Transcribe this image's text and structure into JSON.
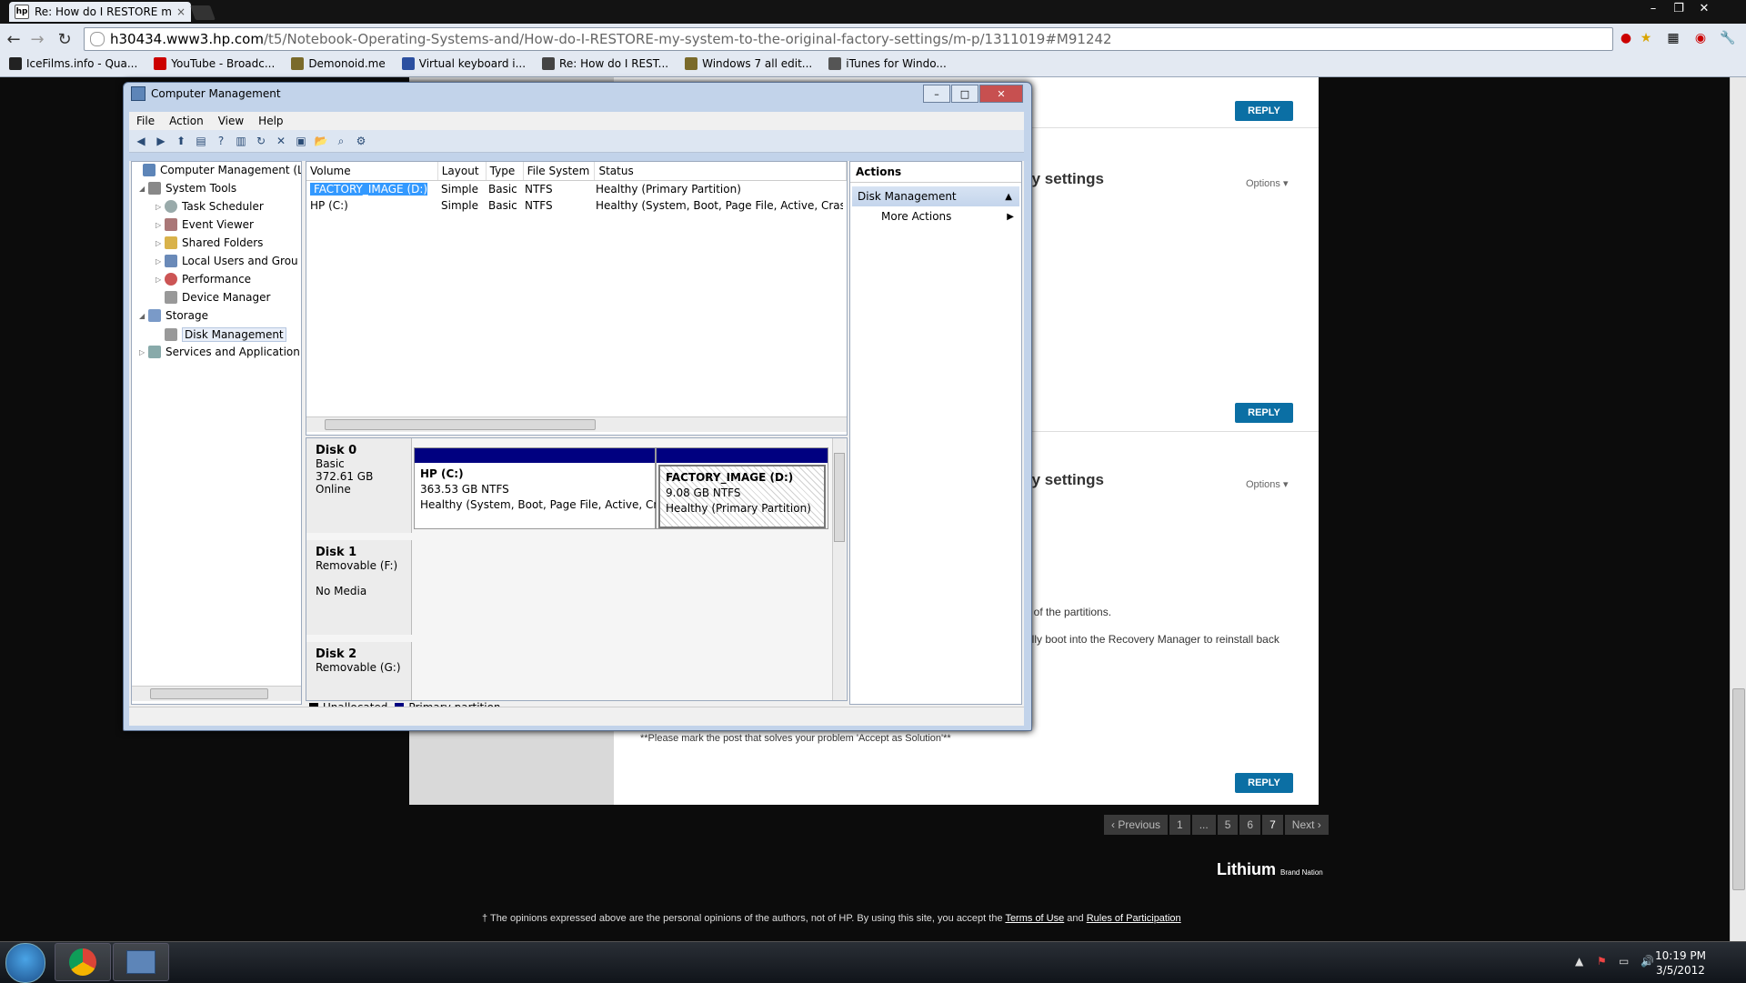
{
  "browser": {
    "tab_title": "Re: How do I RESTORE m",
    "url_host": "h30434.www3.hp.com",
    "url_path": "/t5/Notebook-Operating-Systems-and/How-do-I-RESTORE-my-system-to-the-original-factory-settings/m-p/1311019#M91242",
    "bookmarks": [
      {
        "label": "IceFilms.info - Qua...",
        "color": "#222222"
      },
      {
        "label": "YouTube - Broadc...",
        "color": "#cc0000"
      },
      {
        "label": "Demonoid.me",
        "color": "#7a6a2a"
      },
      {
        "label": "Virtual keyboard i...",
        "color": "#2b4fa0"
      },
      {
        "label": "Re: How do I REST...",
        "color": "#444444"
      },
      {
        "label": "Windows 7 all edit...",
        "color": "#7a6a2a"
      },
      {
        "label": "iTunes for Windo...",
        "color": "#555555"
      }
    ]
  },
  "forum": {
    "reply_label": "REPLY",
    "post_title_fragment": "ry settings",
    "options_label": "Options",
    "body_line1": "ll of the partitions.",
    "body_line2": "ally boot into the Recovery Manager to reinstall back",
    "solution_note": "**Please mark the post that solves your problem 'Accept as Solution'**",
    "pager": {
      "previous": "‹ Previous",
      "p1": "1",
      "ellipsis": "...",
      "p5": "5",
      "p6": "6",
      "p7": "7",
      "next": "Next ›"
    },
    "lithium": "Lithium",
    "lithium_small": "Brand Nation",
    "footer_text": "† The opinions expressed above are the personal opinions of the authors, not of HP. By using this site, you accept the",
    "terms": "Terms of Use",
    "and": "and",
    "rules": "Rules of Participation"
  },
  "cm": {
    "title": "Computer Management",
    "menu": [
      "File",
      "Action",
      "View",
      "Help"
    ],
    "tree": {
      "root": "Computer Management (Lo",
      "system_tools": "System Tools",
      "task_scheduler": "Task Scheduler",
      "event_viewer": "Event Viewer",
      "shared_folders": "Shared Folders",
      "local_users": "Local Users and Grou",
      "performance": "Performance",
      "device_manager": "Device Manager",
      "storage": "Storage",
      "disk_management": "Disk Management",
      "services": "Services and Application"
    },
    "columns": [
      "Volume",
      "Layout",
      "Type",
      "File System",
      "Status"
    ],
    "volumes": [
      {
        "volume": "FACTORY_IMAGE (D:)",
        "layout": "Simple",
        "type": "Basic",
        "fs": "NTFS",
        "status": "Healthy (Primary Partition)"
      },
      {
        "volume": "HP (C:)",
        "layout": "Simple",
        "type": "Basic",
        "fs": "NTFS",
        "status": "Healthy (System, Boot, Page File, Active, Crash D"
      }
    ],
    "disk0": {
      "name": "Disk 0",
      "type": "Basic",
      "size": "372.61 GB",
      "state": "Online"
    },
    "part_c": {
      "name": "HP  (C:)",
      "size": "363.53 GB NTFS",
      "status": "Healthy (System, Boot, Page File, Active, Cra"
    },
    "part_d": {
      "name": "FACTORY_IMAGE  (D:)",
      "size": "9.08 GB NTFS",
      "status": "Healthy (Primary Partition)"
    },
    "disk1": {
      "name": "Disk 1",
      "type": "Removable (F:)",
      "state": "No Media"
    },
    "disk2": {
      "name": "Disk 2",
      "type": "Removable (G:)"
    },
    "legend_unallocated": "Unallocated",
    "legend_primary": "Primary partition",
    "actions_header": "Actions",
    "actions_section": "Disk Management",
    "more_actions": "More Actions"
  },
  "taskbar": {
    "time": "10:19 PM",
    "date": "3/5/2012"
  }
}
